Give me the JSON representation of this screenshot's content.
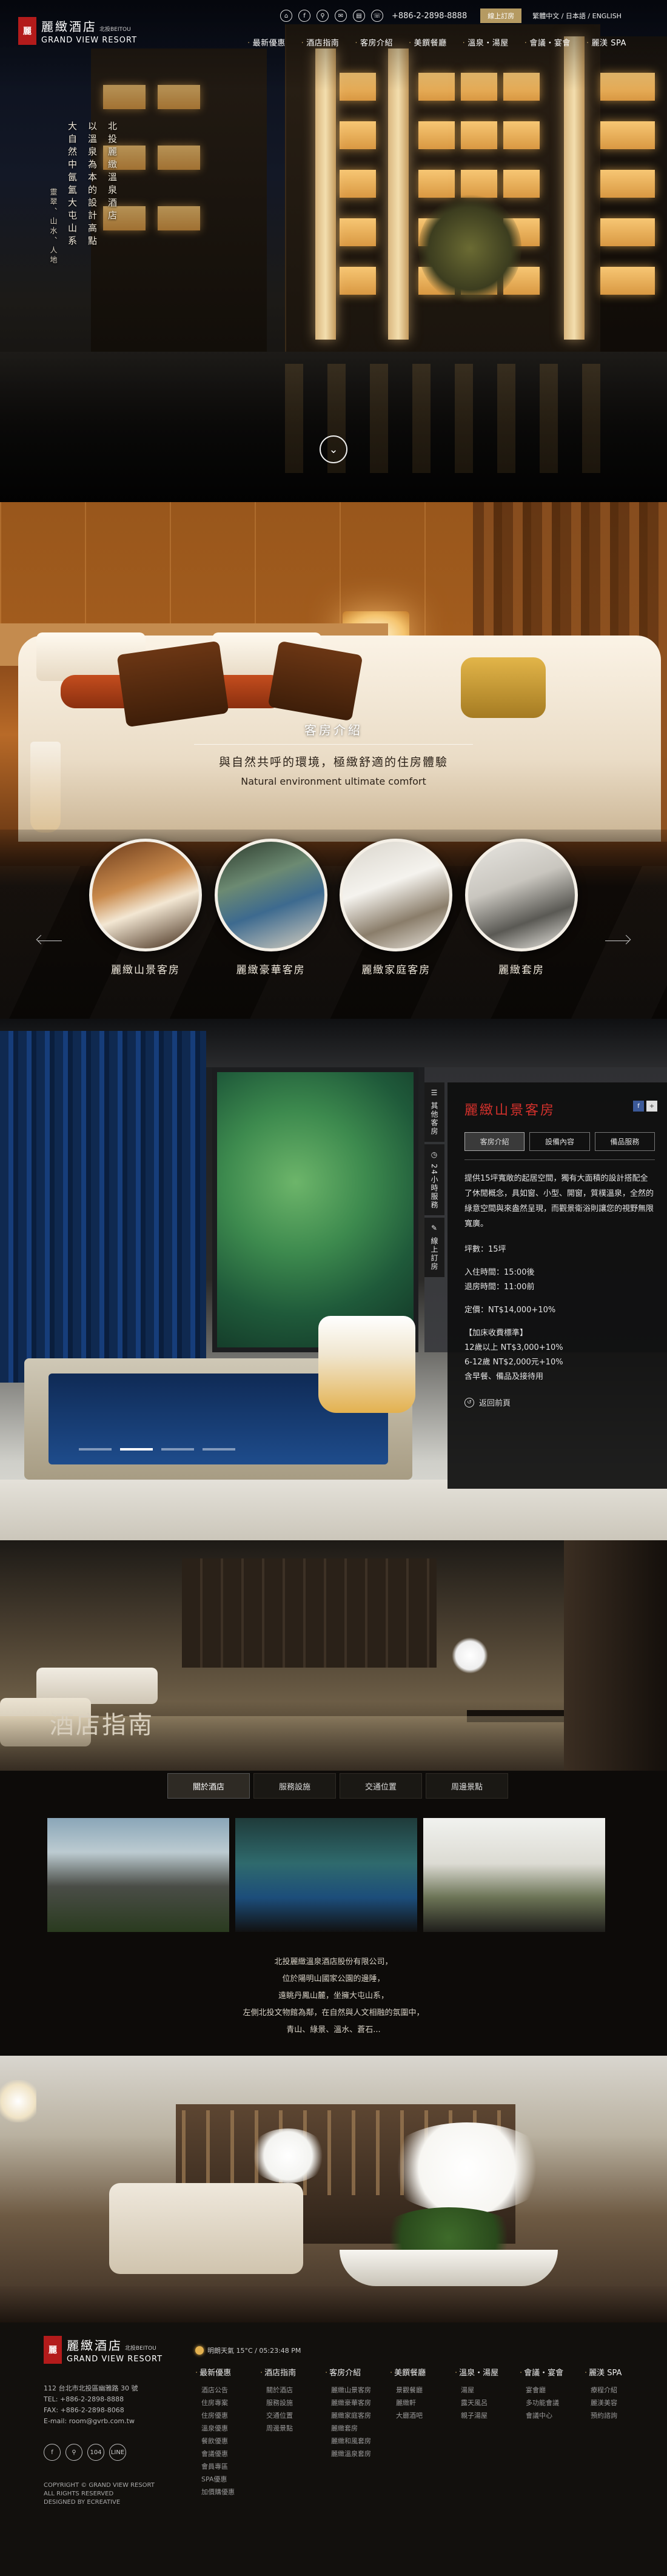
{
  "brand": {
    "name_cn": "麗緻酒店",
    "name_sub": "北投BEITOU",
    "name_en": "GRAND VIEW RESORT",
    "mark": "麗"
  },
  "utility": {
    "icons": [
      "home-icon",
      "facebook-icon",
      "pin-icon",
      "mail-icon",
      "sitemap-icon"
    ],
    "icon_glyphs": [
      "⌂",
      "f",
      "⚲",
      "✉",
      "▤"
    ],
    "phone_icon": "phone-icon",
    "phone": "+886-2-2898-8888",
    "book_button": "線上訂房",
    "languages": "繁體中文 / 日本語 / ENGLISH"
  },
  "nav": [
    "最新優惠",
    "酒店指南",
    "客房介紹",
    "美饌餐廳",
    "溫泉・湯屋",
    "會議・宴會",
    "麗渼 SPA"
  ],
  "hero": {
    "poem_cols": [
      "北投麗緻溫泉酒店",
      "以溫泉為本的設計高點",
      "大自然中氤氳大屯山系"
    ],
    "poem_small": "靈翠、山水、人地",
    "scroll_icon": "chevron-down-icon",
    "scroll_glyph": "⌄"
  },
  "rooms": {
    "category": "客房介紹",
    "headline_cn": "與自然共呼的環境，極緻舒適的住房體驗",
    "headline_en": "Natural environment ultimate comfort",
    "cards": [
      {
        "name": "麗緻山景客房"
      },
      {
        "name": "麗緻豪華客房"
      },
      {
        "name": "麗緻家庭客房"
      },
      {
        "name": "麗緻套房"
      }
    ]
  },
  "detail": {
    "vertical_tabs": [
      {
        "icon": "list-icon",
        "glyph": "☰",
        "label": "其他客房"
      },
      {
        "icon": "clock-icon",
        "glyph": "◷",
        "label": "24小時服務"
      },
      {
        "icon": "edit-icon",
        "glyph": "✎",
        "label": "線上訂房"
      }
    ],
    "title": "麗緻山景客房",
    "share": [
      "f",
      "+"
    ],
    "tabs": [
      "客房介紹",
      "設備內容",
      "備品服務"
    ],
    "description": "提供15坪寬敞的起居空間，獨有大面積的設計搭配全了休閒概念，具如窗、小型、開窗，質樸溫泉，全然的綠意空間與來盎然呈現，而觀景衛浴則讓您的視野無限寬廣。",
    "area": "坪數：15坪",
    "checkin": "入住時間：15:00後",
    "checkout": "退房時間：11:00前",
    "price": "定價：NT$14,000+10%",
    "surcharge_title": "【加床收費標準】",
    "surcharge_1": "12歲以上 NT$3,000+10%",
    "surcharge_2": "6-12歲 NT$2,000元+10%",
    "surcharge_3": "含早餐、備品及接待用",
    "back": "返回前頁",
    "back_icon": "back-icon",
    "back_glyph": "↺",
    "slider_dots": 4,
    "slider_active": 1
  },
  "guide": {
    "title": "酒店指南",
    "tabs": [
      "關於酒店",
      "服務設施",
      "交通位置",
      "周邊景點"
    ],
    "active_tab": 0,
    "text_lines": [
      "北投麗緻溫泉酒店股份有限公司，",
      "位於陽明山國家公園的邊陲，",
      "遠眺丹鳳山麓，坐擁大屯山系，",
      "左側北投文物館為鄰，在自然與人文相融的氛圍中，",
      "青山、綠景、溫水、蒼石..."
    ]
  },
  "footer": {
    "address": "112 台北市北投區幽雅路 30 號",
    "tel": "TEL: +886-2-2898-8888",
    "fax": "FAX: +886-2-2898-8068",
    "email": "E-mail: room@gvrb.com.tw",
    "social": [
      "facebook-icon",
      "pin-icon",
      "tripadvisor-icon",
      "line-icon"
    ],
    "social_glyphs": [
      "f",
      "⚲",
      "104",
      "LINE"
    ],
    "copyright_1": "COPYRIGHT © GRAND VIEW RESORT",
    "copyright_2": "ALL RIGHTS RESERVED",
    "copyright_3": "DESIGNED BY ECREATIVE",
    "weather": "明朗天氣 15°C / 05:23:48 PM",
    "columns": [
      {
        "heading": "最新優惠",
        "items": [
          "酒店公告",
          "住房專案",
          "住房優惠",
          "溫泉優惠",
          "餐飲優惠",
          "會議優惠",
          "會員專區",
          "SPA優惠",
          "加價購優惠"
        ]
      },
      {
        "heading": "酒店指南",
        "items": [
          "關於酒店",
          "服務設施",
          "交通位置",
          "周邊景點"
        ]
      },
      {
        "heading": "客房介紹",
        "items": [
          "麗緻山景客房",
          "麗緻豪華客房",
          "麗緻家庭客房",
          "麗緻套房",
          "麗緻和風套房",
          "麗緻溫泉套房"
        ]
      },
      {
        "heading": "美饌餐廳",
        "items": [
          "景觀餐廳",
          "麗緻軒",
          "大廳酒吧"
        ]
      },
      {
        "heading": "溫泉・湯屋",
        "items": [
          "湯屋",
          "露天風呂",
          "親子湯屋"
        ]
      },
      {
        "heading": "會議・宴會",
        "items": [
          "宴會廳",
          "多功能會議",
          "會議中心"
        ]
      },
      {
        "heading": "麗渼 SPA",
        "items": [
          "療程介紹",
          "麗渼美容",
          "預約諮詢"
        ]
      }
    ]
  }
}
